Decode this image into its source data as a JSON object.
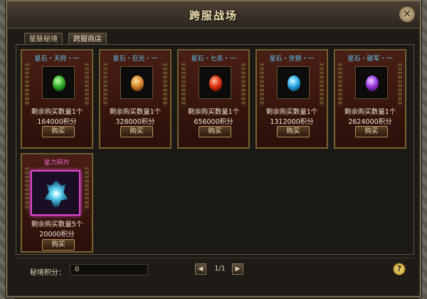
{
  "window": {
    "title": "跨服战场",
    "close_symbol": "✕"
  },
  "tabs": [
    {
      "label": "星脉秘境",
      "active": false
    },
    {
      "label": "跨服商店",
      "active": true
    }
  ],
  "items": [
    {
      "title": "星石・天府・一",
      "icon": "green-gem-icon",
      "color": "#34b02a",
      "remaining": "剩余购买数量1个",
      "price": "164000积分",
      "buy_label": "购买"
    },
    {
      "title": "星石・巨光・一",
      "icon": "orange-gem-icon",
      "color": "#d8882a",
      "remaining": "剩余购买数量1个",
      "price": "328000积分",
      "buy_label": "购买"
    },
    {
      "title": "星石・七杀・一",
      "icon": "red-gem-icon",
      "color": "#e03010",
      "remaining": "剩余购买数量1个",
      "price": "656000积分",
      "buy_label": "购买"
    },
    {
      "title": "星石・贪狼・一",
      "icon": "blue-gem-icon",
      "color": "#2aa8e8",
      "remaining": "剩余购买数量1个",
      "price": "1312000积分",
      "buy_label": "购买"
    },
    {
      "title": "星石・破军・一",
      "icon": "purple-gem-icon",
      "color": "#9a3ae0",
      "remaining": "剩余购买数量1个",
      "price": "2624000积分",
      "buy_label": "购买"
    },
    {
      "title": "星力碎片",
      "icon": "crystal-shard-icon",
      "color": "#5ad0f0",
      "remaining": "剩余购买数量5个",
      "price": "20000积分",
      "buy_label": "购买"
    }
  ],
  "footer": {
    "points_label": "秘境积分：",
    "points_value": "0",
    "page_indicator": "1/1",
    "prev_symbol": "◀",
    "next_symbol": "▶",
    "help_symbol": "?"
  }
}
